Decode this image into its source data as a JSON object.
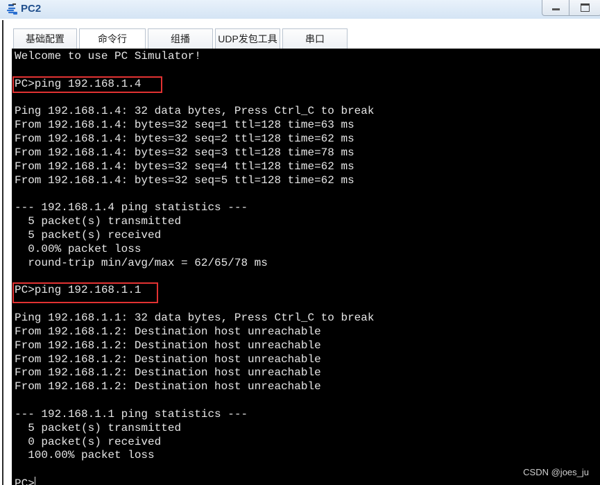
{
  "window": {
    "title": "PC2",
    "icon": "network-pc-icon",
    "controls": {
      "minimize": "minimize-icon",
      "maximize": "maximize-icon"
    }
  },
  "tabs": [
    {
      "label": "基础配置",
      "active": false
    },
    {
      "label": "命令行",
      "active": true
    },
    {
      "label": "组播",
      "active": false
    },
    {
      "label": "UDP发包工具",
      "active": false
    },
    {
      "label": "串口",
      "active": false
    }
  ],
  "terminal": {
    "lines": [
      "Welcome to use PC Simulator!",
      "",
      "PC>ping 192.168.1.4",
      "",
      "Ping 192.168.1.4: 32 data bytes, Press Ctrl_C to break",
      "From 192.168.1.4: bytes=32 seq=1 ttl=128 time=63 ms",
      "From 192.168.1.4: bytes=32 seq=2 ttl=128 time=62 ms",
      "From 192.168.1.4: bytes=32 seq=3 ttl=128 time=78 ms",
      "From 192.168.1.4: bytes=32 seq=4 ttl=128 time=62 ms",
      "From 192.168.1.4: bytes=32 seq=5 ttl=128 time=62 ms",
      "",
      "--- 192.168.1.4 ping statistics ---",
      "  5 packet(s) transmitted",
      "  5 packet(s) received",
      "  0.00% packet loss",
      "  round-trip min/avg/max = 62/65/78 ms",
      "",
      "PC>ping 192.168.1.1",
      "",
      "Ping 192.168.1.1: 32 data bytes, Press Ctrl_C to break",
      "From 192.168.1.2: Destination host unreachable",
      "From 192.168.1.2: Destination host unreachable",
      "From 192.168.1.2: Destination host unreachable",
      "From 192.168.1.2: Destination host unreachable",
      "From 192.168.1.2: Destination host unreachable",
      "",
      "--- 192.168.1.1 ping statistics ---",
      "  5 packet(s) transmitted",
      "  0 packet(s) received",
      "  100.00% packet loss",
      "",
      "PC>"
    ],
    "highlighted_commands": [
      "PC>ping 192.168.1.4",
      "PC>ping 192.168.1.1"
    ],
    "highlight_color": "#e23232"
  },
  "watermark": "CSDN @joes_ju"
}
